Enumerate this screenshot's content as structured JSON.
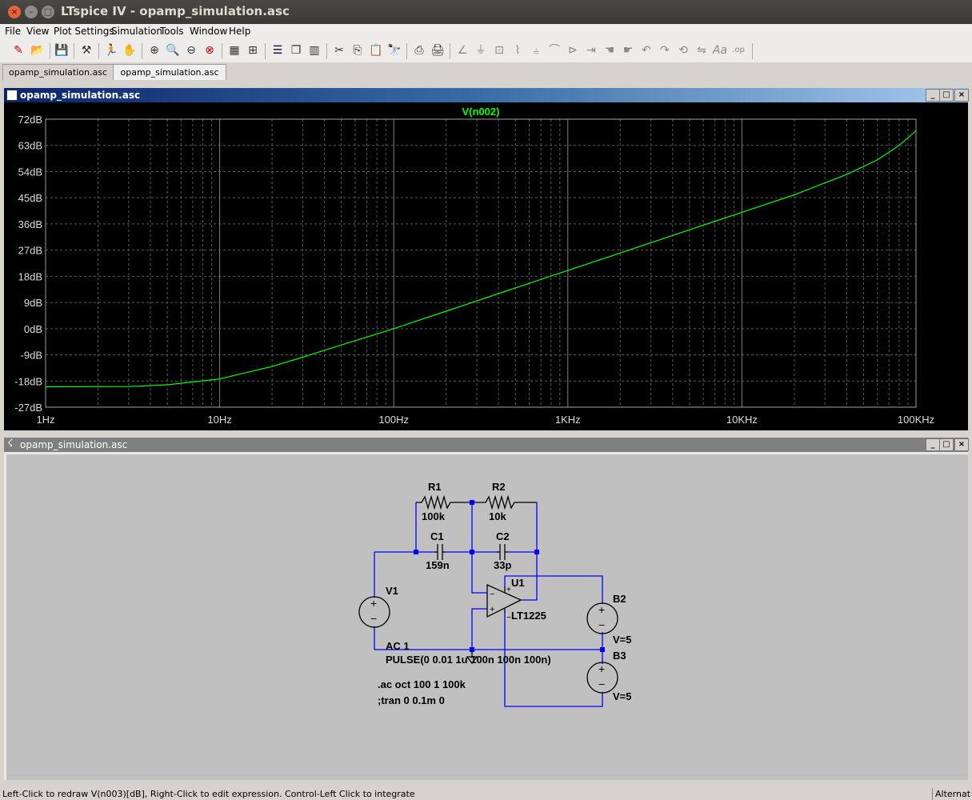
{
  "window": {
    "title": "LTspice IV - opamp_simulation.asc",
    "controls": [
      "×",
      "–",
      "□"
    ]
  },
  "menu": [
    "File",
    "View",
    "Plot Settings",
    "Simulation",
    "Tools",
    "Window",
    "Help"
  ],
  "toolbar": {
    "icons": [
      "new-schematic-icon",
      "open-icon",
      "save-icon",
      "control-panel-icon",
      "run-icon",
      "halt-icon",
      "zoom-in-icon",
      "pan-icon",
      "zoom-out-icon",
      "zoom-cancel-icon",
      "autorange-icon",
      "fit-icon",
      "tile-horizontal-icon",
      "cascade-icon",
      "tile-vertical-icon",
      "cut-icon",
      "copy-icon",
      "paste-icon",
      "find-icon",
      "print-setup-icon",
      "print-icon",
      "wire-icon",
      "ground-icon",
      "label-icon",
      "resistor-icon",
      "capacitor-icon",
      "inductor-icon",
      "diode-icon",
      "component-icon",
      "move-icon",
      "drag-icon",
      "undo-icon",
      "redo-icon",
      "rotate-icon",
      "mirror-icon",
      "text-icon",
      "spice-directive-icon"
    ]
  },
  "tabs": [
    {
      "label": "opamp_simulation.asc",
      "active": false
    },
    {
      "label": "opamp_simulation.asc",
      "active": true
    }
  ],
  "plot_window": {
    "title": "opamp_simulation.asc",
    "controls": [
      "_",
      "□",
      "×"
    ]
  },
  "schematic_window": {
    "title": "opamp_simulation.asc",
    "controls": [
      "_",
      "□",
      "×"
    ]
  },
  "chart_data": {
    "type": "line",
    "title": "V(n002)",
    "xscale": "log",
    "xlim": [
      1,
      100000
    ],
    "ylim": [
      -27,
      72
    ],
    "xticks": [
      "1Hz",
      "10Hz",
      "100Hz",
      "1KHz",
      "10KHz",
      "100KHz"
    ],
    "yticks": [
      "72dB",
      "63dB",
      "54dB",
      "45dB",
      "36dB",
      "27dB",
      "18dB",
      "9dB",
      "0dB",
      "-9dB",
      "-18dB",
      "-27dB"
    ],
    "grid": true,
    "series": [
      {
        "name": "V(n002)",
        "color": "#00ff00",
        "x": [
          1,
          3,
          5,
          10,
          20,
          30,
          50,
          70,
          100,
          200,
          500,
          1000,
          2000,
          5000,
          10000,
          20000,
          40000,
          60000,
          80000,
          100000
        ],
        "y": [
          -20,
          -19.9,
          -19.3,
          -17.3,
          -13,
          -9.8,
          -5.6,
          -2.9,
          0,
          6,
          14,
          20,
          26,
          34,
          40,
          46,
          53,
          58,
          63,
          68
        ]
      }
    ]
  },
  "schematic": {
    "components": {
      "R1": {
        "name": "R1",
        "value": "100k"
      },
      "R2": {
        "name": "R2",
        "value": "10k"
      },
      "C1": {
        "name": "C1",
        "value": "159n"
      },
      "C2": {
        "name": "C2",
        "value": "33p"
      },
      "U1": {
        "name": "U1",
        "value": "LT1225"
      },
      "V1": {
        "name": "V1",
        "value1": "AC 1",
        "value2": "PULSE(0 0.01 1u 100n 100n 100n)"
      },
      "B2": {
        "name": "B2",
        "value": "V=5"
      },
      "B3": {
        "name": "B3",
        "value": "V=5"
      }
    },
    "directives": [
      ".ac oct 100 1 100k",
      ";tran 0 0.1m 0"
    ],
    "wire_color": "#0000ff"
  },
  "status": {
    "text": "Left-Click to redraw V(n003)[dB],  Right-Click to edit expression. Control-Left Click to integrate",
    "mode": "Alternat"
  }
}
